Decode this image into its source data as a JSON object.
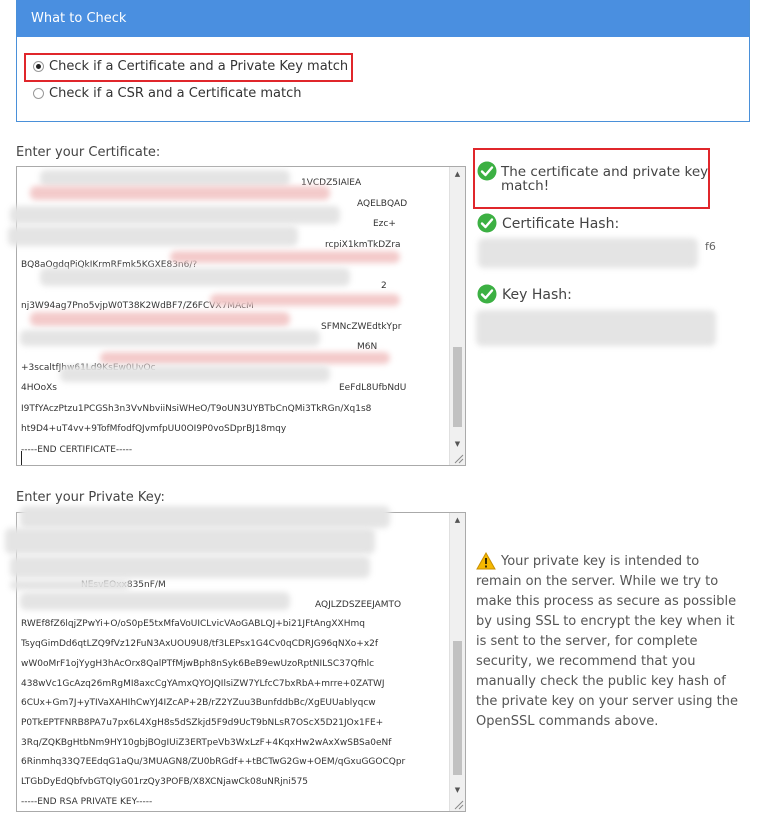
{
  "panel": {
    "title": "What to Check",
    "options": [
      {
        "label": "Check if a Certificate and a Private Key match",
        "selected": true
      },
      {
        "label": "Check if a CSR and a Certificate match",
        "selected": false
      }
    ]
  },
  "certificate": {
    "label": "Enter your Certificate:",
    "lines": [
      "",
      "",
      "",
      "",
      "BQ8aOgdqPiQkIKrmRFmk5KGXE83n6/?",
      "",
      "nj3W94ag7Pno5vjpW0T38K2WdBF7/Z6FCVX7MAcM",
      "",
      "",
      "+3scaltfJhw61Ld9KsEw0UvOc",
      "4HOoXs",
      "I9TfYAczPtzu1PCGSh3n3VvNbviiNsiWHeO/T9oUN3UYBTbCnQMi3TkRGn/Xq1s8",
      "ht9D4+uT4vv+9TofMfodfQJvmfpUU0OI9P0voSDprBJ18mqy",
      "-----END CERTIFICATE-----"
    ],
    "line1_tail": "1VCDZ5IAlEA",
    "line2_tail": "AQELBQAD",
    "line3_tail": "Ezc+",
    "line4_tail": "rcpiX1kmTkDZra",
    "line6_tail": "2",
    "line8_tail": "SFMNcZWEdtkYpr",
    "line9_tail": "M6N",
    "line11_tail": "EeFdL8UfbNdU"
  },
  "private_key": {
    "label": "Enter your Private Key:",
    "lines": [
      "",
      "",
      "",
      "",
      "",
      "RWEf8fZ6lqjZPwYi+O/oS0pE5txMfaVoUICLvicVAoGABLQJ+bi21JFtAngXXHmq",
      "TsyqGimDd6qtLZQ9fVz12FuN3AxUOU9U8/tf3LEPsx1G4Cv0qCDRJG96qNXo+x2f",
      "wW0oMrF1ojYygH3hAcOrx8QalPTfMjwBph8nSyk6BeB9ewUzoRptNILSC37Qfhlc",
      "438wVc1GcAzq26mRgMI8axcCgYAmxQYOJQIlsiZW7YLfcC7bxRbA+mrre+0ZATWJ",
      "6CUx+Gm7J+yTIVaXAHIhCwYJ4IZcAP+2B/rZ2YZuu3BunfddbBc/XgEUUablyqcw",
      "P0TkEPTFNRB8PA7u7px6L4XgH8s5dSZkjd5F9d9UcT9bNLsR7OScX5D21JOx1FE+",
      "3Rq/ZQKBgHtbNm9HY10gbjBOgIUiZ3ERTpeVb3WxLzF+4KqxHw2wAxXwSBSa0eNf",
      "6Rinmhq33Q7EEdqG1aQu/3MUAGN8/ZU0bRGdf++tBCTwG2Gw+OEM/qGxuGGOCQpr",
      "LTGbDyEdQbfvbGTQIyG01rzQy3POFB/X8XCNjawCk08uNRjni575",
      "-----END RSA PRIVATE KEY-----"
    ],
    "line4_tail": "NEsvEOxx835nF/M",
    "line5_tail": "AQJLZDSZEEJAMTO"
  },
  "results": {
    "match_message": "The certificate and private key match!",
    "cert_hash_label": "Certificate Hash:",
    "cert_hash_tail": "f6",
    "key_hash_label": "Key Hash:"
  },
  "warning": {
    "text": "Your private key is intended to remain on the server. While we try to make this process as secure as possible by using SSL to encrypt the key when it is sent to the server, for complete security, we recommend that you manually check the public key hash of the private key on your server using the OpenSSL commands above."
  },
  "colors": {
    "header_blue": "#4a8fe0",
    "highlight_red": "#e0262b",
    "success_green": "#3cb043",
    "warning_yellow": "#f5b800"
  }
}
